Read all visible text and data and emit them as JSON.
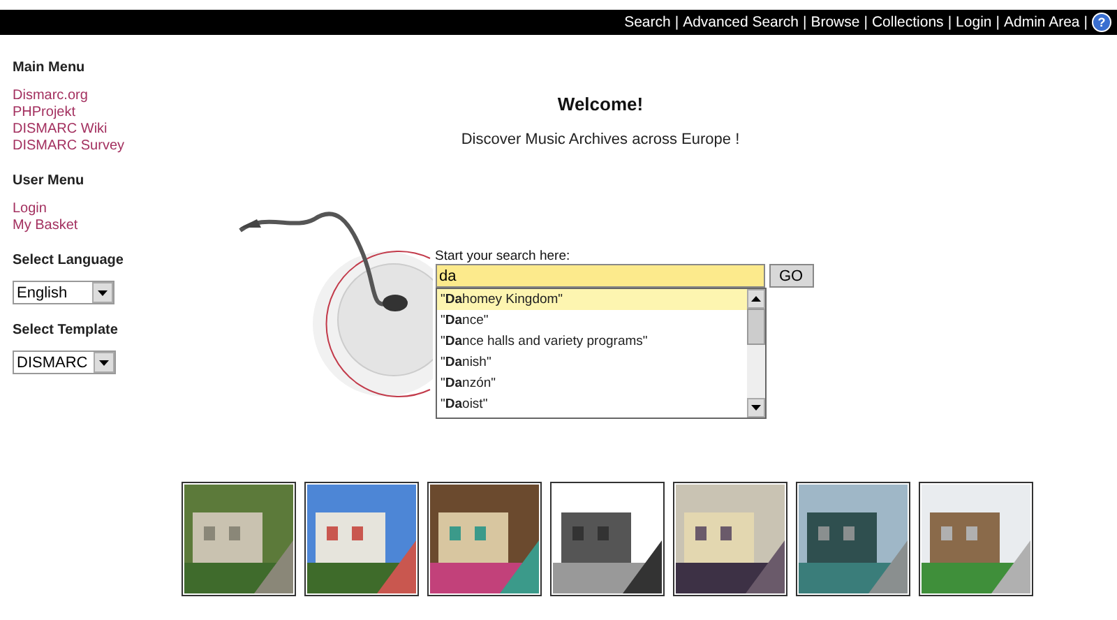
{
  "top_nav": {
    "separator": "|",
    "links": [
      {
        "label": "Search"
      },
      {
        "label": "Advanced Search"
      },
      {
        "label": "Browse"
      },
      {
        "label": "Collections"
      },
      {
        "label": "Login"
      },
      {
        "label": "Admin Area"
      }
    ],
    "help_icon": "?"
  },
  "sidebar": {
    "sections": [
      {
        "kind": "menu",
        "title": "Main Menu",
        "items": [
          "Dismarc.org",
          "PHProjekt",
          "DISMARC Wiki",
          "DISMARC Survey"
        ]
      },
      {
        "kind": "menu",
        "title": "User Menu",
        "items": [
          "Login",
          "My Basket"
        ]
      },
      {
        "kind": "select",
        "title": "Select Language",
        "value": "English"
      },
      {
        "kind": "select",
        "title": "Select Template",
        "value": "DISMARC"
      }
    ]
  },
  "welcome": {
    "title": "Welcome!",
    "subtitle": "Discover Music Archives across Europe !"
  },
  "search": {
    "label": "Start your search here:",
    "value": "da",
    "button": "GO",
    "suggestions": [
      {
        "text": "\"**Da**homey Kingdom\"",
        "selected": true
      },
      {
        "text": "\"**Da**nce\"",
        "selected": false
      },
      {
        "text": "\"**Da**nce halls and variety programs\"",
        "selected": false
      },
      {
        "text": "\"**Da**nish\"",
        "selected": false
      },
      {
        "text": "\"**Da**nzón\"",
        "selected": false
      },
      {
        "text": "\"**Da**oist\"",
        "selected": false
      }
    ]
  }
}
